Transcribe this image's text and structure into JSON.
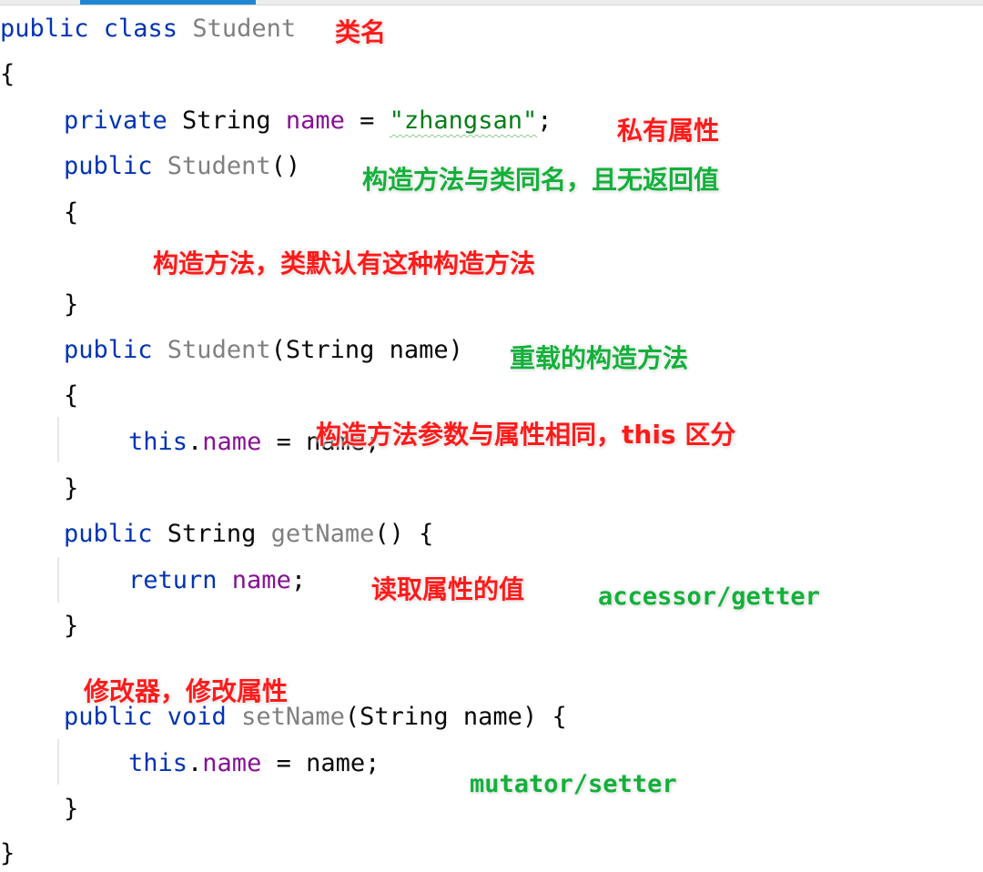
{
  "editor": {
    "colors": {
      "keyword": "#0033b3",
      "class_name": "#808080",
      "field": "#871094",
      "string": "#067d17",
      "plain": "#080808",
      "annotation_red": "#ff1a1a",
      "annotation_green": "#13b03a",
      "tab_active": "#1f86d3"
    },
    "lines": {
      "l1": {
        "kw": "public class ",
        "cls": "Student"
      },
      "l2": {
        "plain": "{"
      },
      "l3": {
        "kw": "private ",
        "type": "String ",
        "fld": "name",
        "eq": " = ",
        "str": "\"zhangsan\"",
        "end": ";"
      },
      "l4": {
        "kw": "public ",
        "cls": "Student",
        "paren": "()"
      },
      "l5": {
        "plain": "{"
      },
      "l6": {
        "plain": "}"
      },
      "l7": {
        "kw": "public ",
        "cls": "Student",
        "rest": "(String name)"
      },
      "l8": {
        "plain": "{"
      },
      "l9": {
        "kw": "this",
        "dot": ".",
        "fld": "name",
        "rest": " = name;"
      },
      "l10": {
        "plain": "}"
      },
      "l11": {
        "kw": "public ",
        "type": "String ",
        "cls": "getName",
        "rest": "() {"
      },
      "l12": {
        "kw": "return ",
        "fld": "name",
        "end": ";"
      },
      "l13": {
        "plain": "}"
      },
      "l14": {
        "kw": "public void ",
        "cls": "setName",
        "rest": "(String name) {"
      },
      "l15": {
        "kw": "this",
        "dot": ".",
        "fld": "name",
        "rest": " = name;"
      },
      "l16": {
        "plain": "}"
      },
      "l17": {
        "plain": "}"
      }
    }
  },
  "annotations": {
    "class_name": "类名",
    "private_field": "私有属性",
    "constructor_same_name": "构造方法与类同名，且无返回值",
    "default_constructor": "构造方法，类默认有这种构造方法",
    "overloaded_constructor": "重载的构造方法",
    "this_distinguish": "构造方法参数与属性相同，this 区分",
    "read_value": "读取属性的值",
    "accessor": "accessor/getter",
    "modifier": "修改器，修改属性",
    "mutator": "mutator/setter"
  }
}
